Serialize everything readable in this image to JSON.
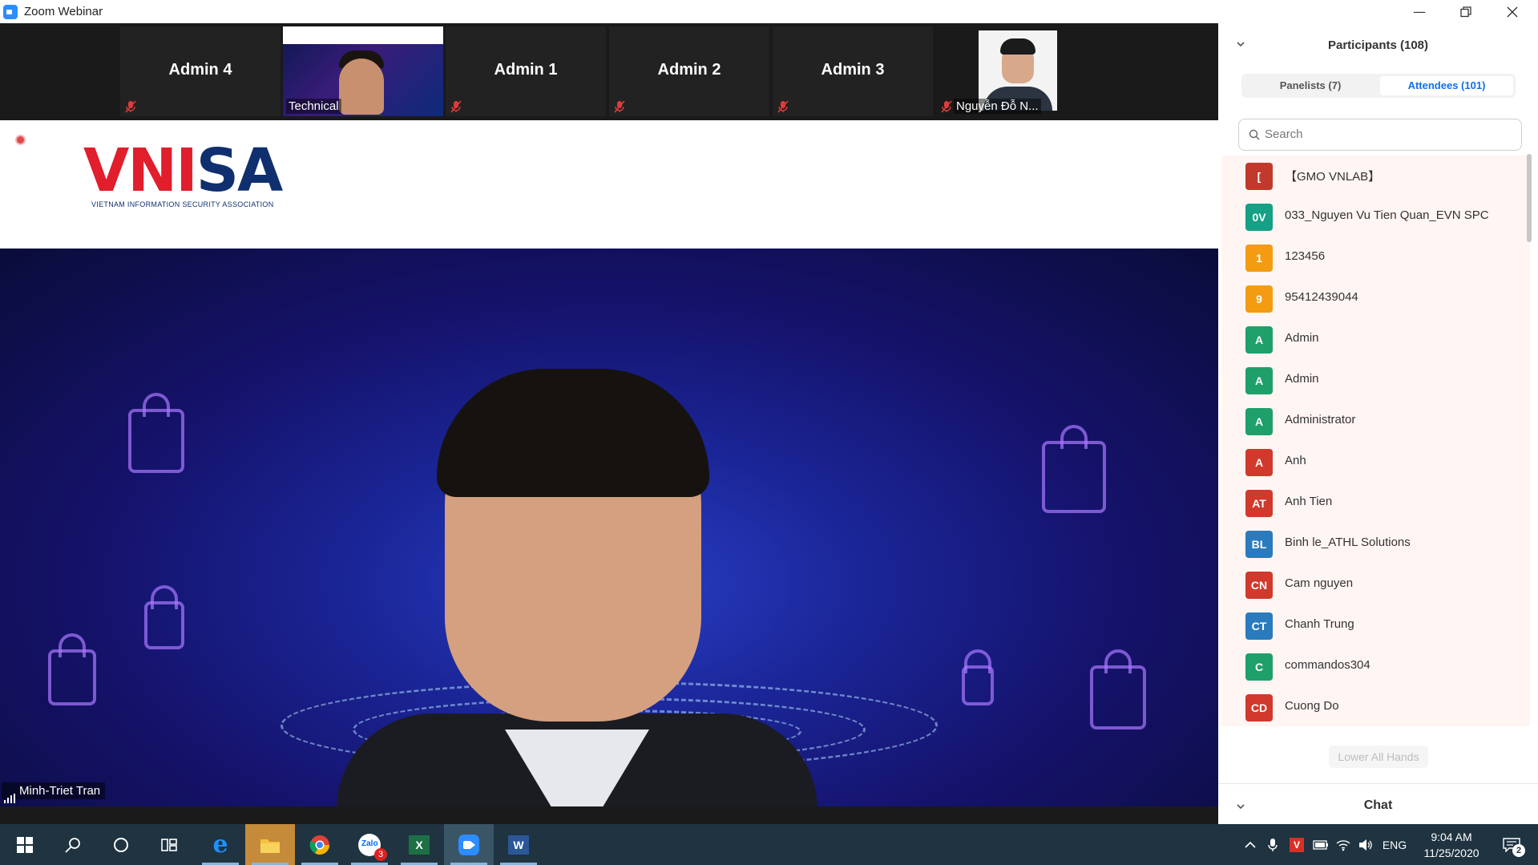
{
  "window": {
    "title": "Zoom Webinar",
    "controls": [
      "minimize",
      "restore",
      "close"
    ]
  },
  "gallery": [
    {
      "name": "Admin 4",
      "muted": true
    },
    {
      "name": "Technical",
      "muted": true,
      "has_video": true
    },
    {
      "name": "Admin 1",
      "muted": true
    },
    {
      "name": "Admin 2",
      "muted": true
    },
    {
      "name": "Admin 3",
      "muted": true
    },
    {
      "name": "Nguyễn Đỗ N...",
      "muted": true,
      "has_photo": true
    }
  ],
  "speaker": {
    "name": "Minh-Triet Tran",
    "banner_logo": "VNISA",
    "banner_logo_sub": "VIETNAM INFORMATION SECURITY ASSOCIATION"
  },
  "participants": {
    "title": "Participants (108)",
    "tabs": [
      {
        "label": "Panelists (7)",
        "active": false
      },
      {
        "label": "Attendees (101)",
        "active": true
      }
    ],
    "search_placeholder": "Search",
    "attendees": [
      {
        "initials": "[",
        "name": "【GMO VNLAB】",
        "color": "#c0392b"
      },
      {
        "initials": "0V",
        "name": "033_Nguyen Vu Tien Quan_EVN SPC",
        "color": "#16a085"
      },
      {
        "initials": "1",
        "name": "123456",
        "color": "#f39c12"
      },
      {
        "initials": "9",
        "name": "95412439044",
        "color": "#f39c12"
      },
      {
        "initials": "A",
        "name": "Admin",
        "color": "#1fa06a"
      },
      {
        "initials": "A",
        "name": "Admin",
        "color": "#1fa06a"
      },
      {
        "initials": "A",
        "name": "Administrator",
        "color": "#1fa06a"
      },
      {
        "initials": "A",
        "name": "Anh",
        "color": "#d0392b"
      },
      {
        "initials": "AT",
        "name": "Anh Tien",
        "color": "#d0392b"
      },
      {
        "initials": "BL",
        "name": "Binh le_ATHL Solutions",
        "color": "#2a7bbd"
      },
      {
        "initials": "CN",
        "name": "Cam nguyen",
        "color": "#d0392b"
      },
      {
        "initials": "CT",
        "name": "Chanh Trung",
        "color": "#2a7bbd"
      },
      {
        "initials": "C",
        "name": "commandos304",
        "color": "#1fa06a"
      },
      {
        "initials": "CD",
        "name": "Cuong Do",
        "color": "#d0392b"
      }
    ],
    "lower_all_hands_label": "Lower All Hands",
    "chat_title": "Chat"
  },
  "taskbar": {
    "apps": [
      "start-icon",
      "search-icon",
      "cortana-icon",
      "task-view-icon",
      "edge-icon",
      "file-explorer-icon",
      "chrome-icon",
      "zalo-icon",
      "excel-icon",
      "zoom-icon",
      "word-icon"
    ],
    "zalo_badge": "3",
    "language": "ENG",
    "time": "9:04 AM",
    "date": "11/25/2020",
    "notification_count": "2"
  }
}
